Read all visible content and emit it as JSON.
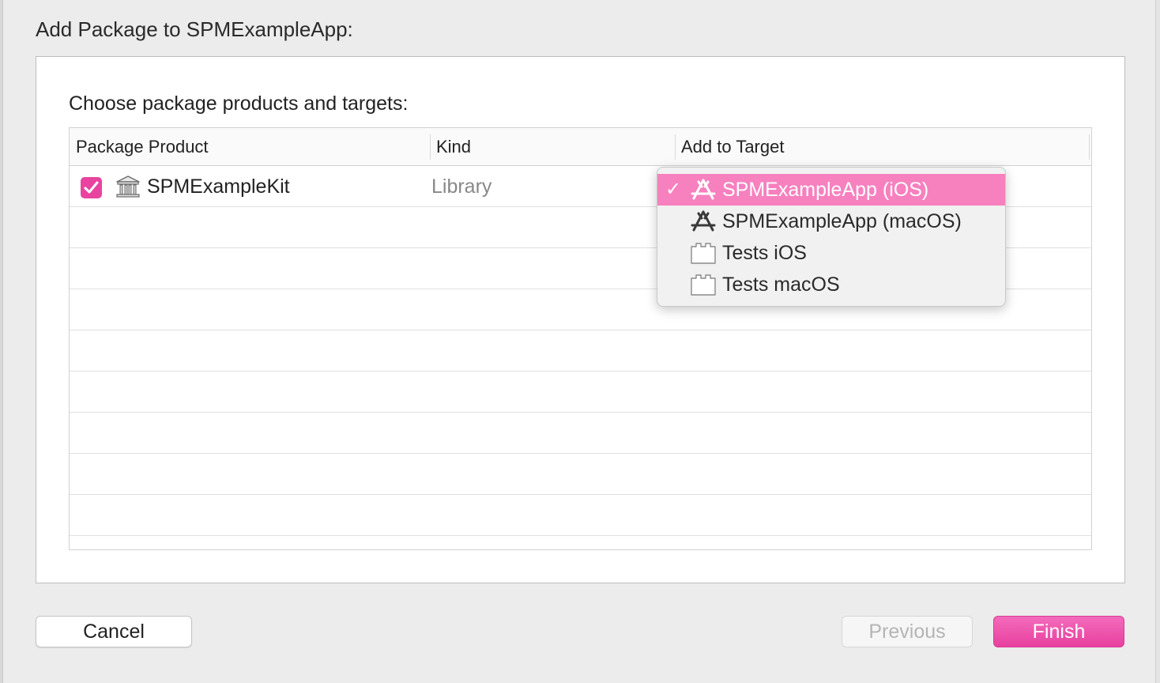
{
  "sheet": {
    "title": "Add Package to SPMExampleApp:"
  },
  "section": {
    "label": "Choose package products and targets:"
  },
  "table": {
    "columns": [
      "Package Product",
      "Kind",
      "Add to Target"
    ],
    "rows": [
      {
        "checked": true,
        "icon": "library-icon",
        "product": "SPMExampleKit",
        "kind": "Library"
      }
    ]
  },
  "target_menu": {
    "items": [
      {
        "label": "SPMExampleApp (iOS)",
        "icon": "app-store-icon",
        "selected": true
      },
      {
        "label": "SPMExampleApp (macOS)",
        "icon": "app-store-icon",
        "selected": false
      },
      {
        "label": "Tests iOS",
        "icon": "test-bundle-icon",
        "selected": false
      },
      {
        "label": "Tests macOS",
        "icon": "test-bundle-icon",
        "selected": false
      }
    ]
  },
  "buttons": {
    "cancel": "Cancel",
    "previous": "Previous",
    "finish": "Finish"
  },
  "colors": {
    "accent": "#e8449f",
    "menu_selection": "#f780bf",
    "disabled_text": "#b5b5b5"
  }
}
